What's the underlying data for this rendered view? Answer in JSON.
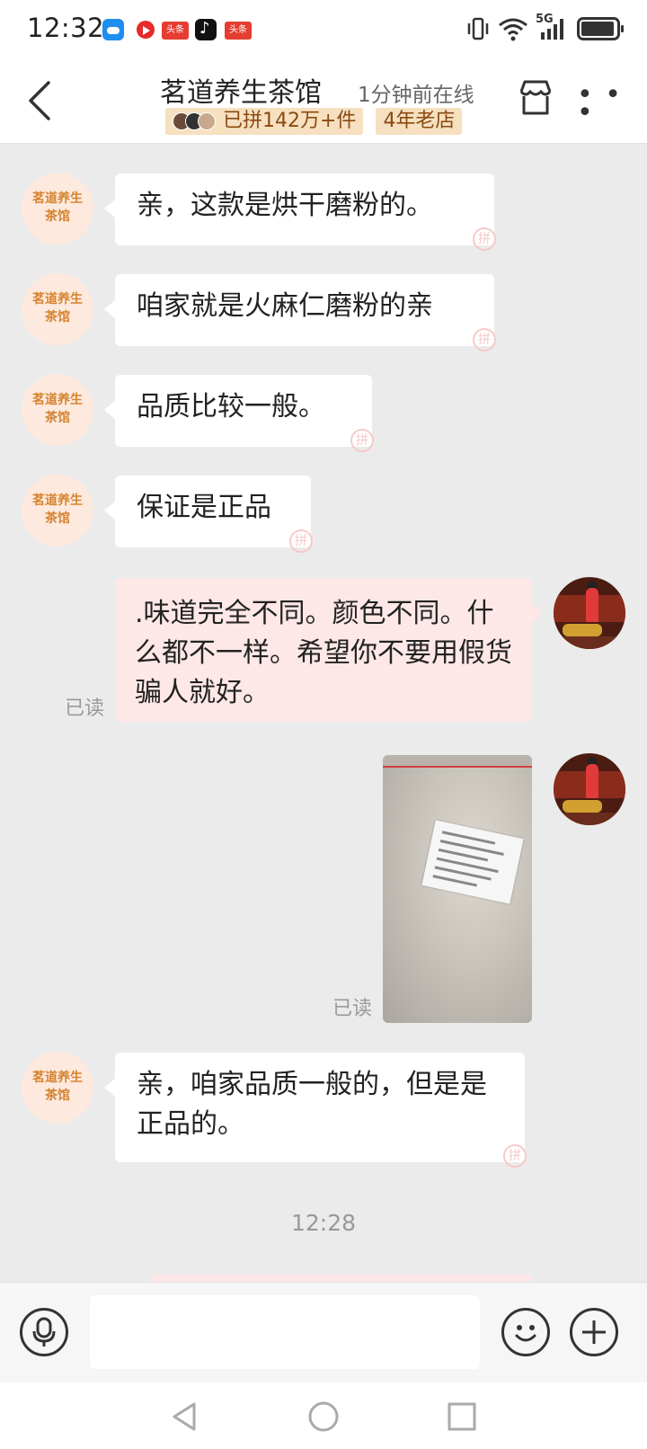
{
  "status_bar": {
    "time": "12:32",
    "app_icons": [
      "weather-icon",
      "video-icon",
      "toutiao-icon",
      "tiktok-icon",
      "toutiao-icon"
    ],
    "toutiao_label": "头条",
    "network": "5G"
  },
  "header": {
    "shop_name": "茗道养生茶馆",
    "online_status": "1分钟前在线",
    "sold_badge": "已拼142万+件",
    "age_badge": "4年老店"
  },
  "shop_avatar_text": "茗道养生茶馆",
  "messages": [
    {
      "from": "shop",
      "text": "亲，这款是烘干磨粉的。"
    },
    {
      "from": "shop",
      "text": "咱家就是火麻仁磨粉的亲"
    },
    {
      "from": "shop",
      "text": "品质比较一般。"
    },
    {
      "from": "shop",
      "text": "保证是正品"
    },
    {
      "from": "user",
      "text": ".味道完全不同。颜色不同。什么都不一样。希望你不要用假货骗人就好。",
      "status": "已读"
    },
    {
      "from": "user",
      "type": "image",
      "status": "已读"
    },
    {
      "from": "shop",
      "text": "亲，咱家品质一般的，但是是正品的。"
    }
  ],
  "pin_mark": "拼",
  "time_separator": "12:28",
  "input": {
    "placeholder": ""
  },
  "colors": {
    "outgoing_bubble": "#fde8e7",
    "incoming_bubble": "#ffffff",
    "badge_bg": "#f6e0c0",
    "background": "#ebebeb"
  }
}
